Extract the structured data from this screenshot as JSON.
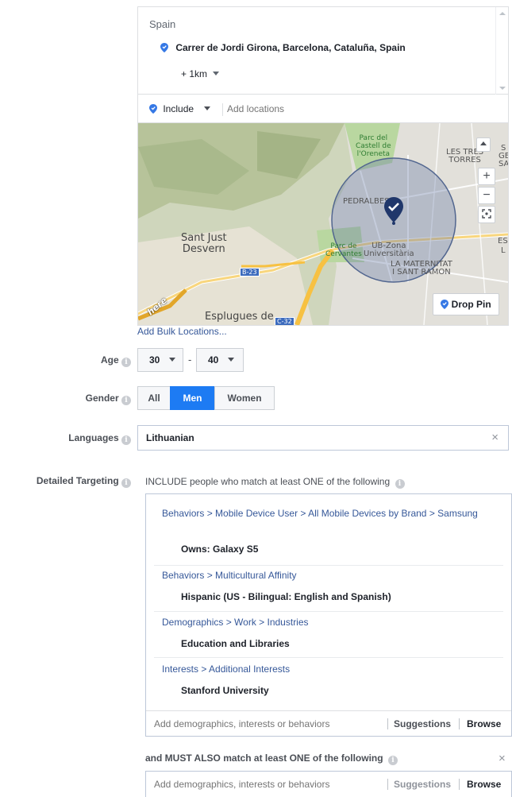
{
  "location": {
    "country": "Spain",
    "address": "Carrer de Jordi Girona, Barcelona, Cataluña, Spain",
    "radius": "+ 1km",
    "mode": "Include",
    "add_placeholder": "Add locations",
    "bulk_link": "Add Bulk Locations..."
  },
  "map": {
    "labels": {
      "parc_castell": "Parc del\nCastell de\nl'Oreneta",
      "les_tres_torres": "LES TRES\nTORRES",
      "pedralbes": "PEDRALBES",
      "sant_just": "Sant Just\nDesvern",
      "parc_cervantes": "Parc de\nCervantes",
      "ub_zona": "UB-Zona\nUniversitària",
      "maternitat": "LA MATERNITAT\nI SANT RAMON",
      "esplugues": "Esplugues de",
      "road_b23": "B-23",
      "road_c32": "C-32",
      "edge_s": "S",
      "edge_ge": "GE",
      "edge_sa": "SA",
      "edge_es": "ES",
      "edge_l": "L",
      "here_logo": "here"
    },
    "zoom_in": "+",
    "zoom_out": "−",
    "drop_pin": "Drop Pin"
  },
  "age": {
    "label": "Age",
    "min": "30",
    "sep": "-",
    "max": "40"
  },
  "gender": {
    "label": "Gender",
    "options": [
      "All",
      "Men",
      "Women"
    ],
    "selected": "Men"
  },
  "languages": {
    "label": "Languages",
    "value": "Lithuanian",
    "clear": "×"
  },
  "detailed": {
    "label": "Detailed Targeting",
    "include_heading": "INCLUDE people who match at least ONE of the following",
    "items": [
      {
        "path": "Behaviors > Mobile Device User > All Mobile Devices by Brand > Samsung",
        "value": "Owns: Galaxy S5"
      },
      {
        "path": "Behaviors > Multicultural Affinity",
        "value": "Hispanic (US - Bilingual: English and Spanish)"
      },
      {
        "path": "Demographics > Work > Industries",
        "value": "Education and Libraries"
      },
      {
        "path": "Interests > Additional Interests",
        "value": "Stanford University"
      }
    ],
    "add_placeholder": "Add demographics, interests or behaviors",
    "suggestions": "Suggestions",
    "browse": "Browse",
    "must_heading": "and MUST ALSO match at least ONE of the following",
    "must_close": "×",
    "must_add_placeholder": "Add demographics, interests or behaviors",
    "must_suggestions": "Suggestions",
    "must_browse": "Browse"
  },
  "colors": {
    "accent": "#1d7bf3",
    "link": "#365899",
    "pin": "#20376b",
    "radius_fill": "#6b7fa8"
  }
}
